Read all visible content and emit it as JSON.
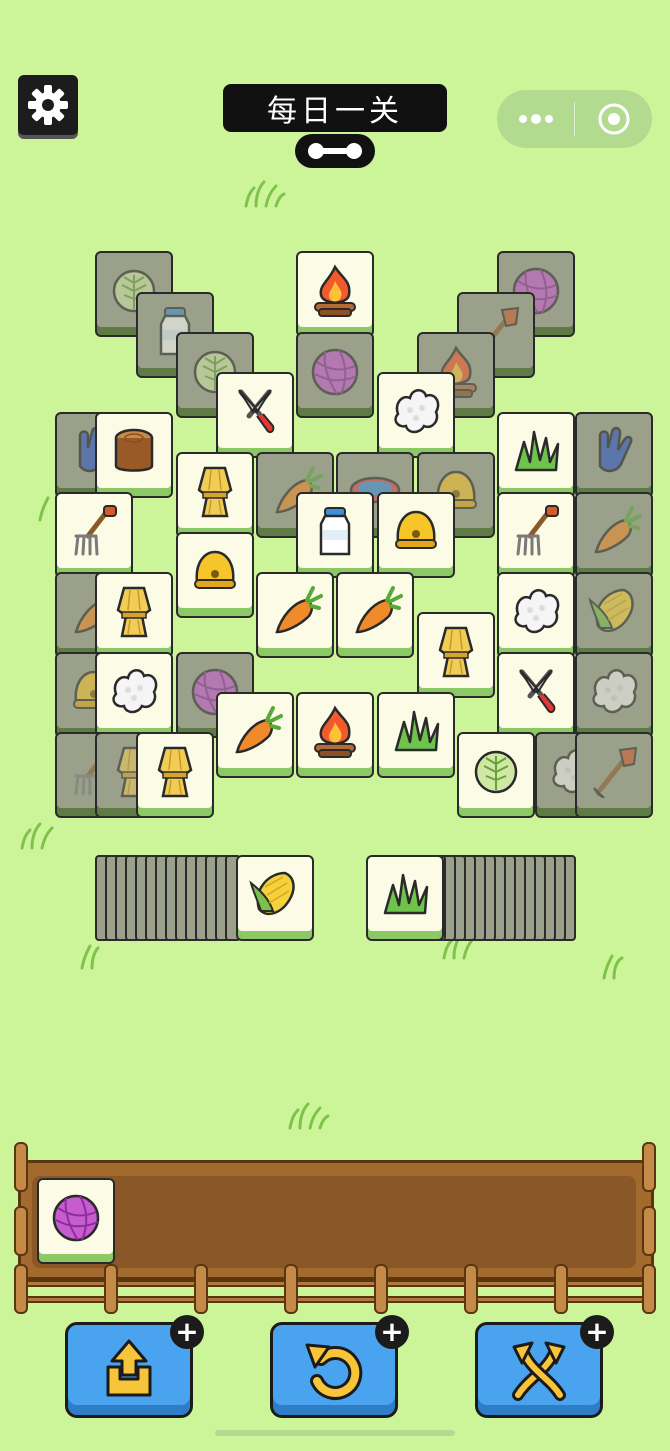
{
  "title": "每日一关",
  "settings_icon": "gear-icon",
  "capsule": {
    "menu_icon": "more-dots-icon",
    "close_icon": "target-close-icon"
  },
  "board": {
    "tiles": [
      {
        "item": "cabbage",
        "dim": true
      },
      {
        "item": "campfire",
        "dim": false
      },
      {
        "item": "yarn",
        "dim": true
      },
      {
        "item": "milk",
        "dim": true
      },
      {
        "item": "shovel",
        "dim": true
      },
      {
        "item": "cabbage",
        "dim": true
      },
      {
        "item": "yarn",
        "dim": true
      },
      {
        "item": "campfire",
        "dim": true
      },
      {
        "item": "glove",
        "dim": true
      },
      {
        "item": "glove",
        "dim": true
      },
      {
        "item": "shears",
        "dim": false
      },
      {
        "item": "cauliflower",
        "dim": false
      },
      {
        "item": "stump",
        "dim": false
      },
      {
        "item": "wheat",
        "dim": false
      },
      {
        "item": "carrot",
        "dim": true
      },
      {
        "item": "bowl",
        "dim": true
      },
      {
        "item": "bell",
        "dim": true
      },
      {
        "item": "grass",
        "dim": false
      },
      {
        "item": "fork",
        "dim": false
      },
      {
        "item": "milk",
        "dim": false
      },
      {
        "item": "bell",
        "dim": false
      },
      {
        "item": "fork",
        "dim": false
      },
      {
        "item": "carrot",
        "dim": true
      },
      {
        "item": "carrot",
        "dim": true
      },
      {
        "item": "wheat",
        "dim": false
      },
      {
        "item": "bell",
        "dim": false
      },
      {
        "item": "carrot",
        "dim": false
      },
      {
        "item": "carrot",
        "dim": false
      },
      {
        "item": "cauliflower",
        "dim": false
      },
      {
        "item": "corn",
        "dim": true
      },
      {
        "item": "bell",
        "dim": true
      },
      {
        "item": "cauliflower",
        "dim": false
      },
      {
        "item": "yarn",
        "dim": true
      },
      {
        "item": "wheat",
        "dim": false
      },
      {
        "item": "shears",
        "dim": false
      },
      {
        "item": "cauliflower",
        "dim": true
      },
      {
        "item": "fork",
        "dim": true
      },
      {
        "item": "wheat",
        "dim": true
      },
      {
        "item": "wheat",
        "dim": false
      },
      {
        "item": "carrot",
        "dim": false
      },
      {
        "item": "campfire",
        "dim": false
      },
      {
        "item": "grass",
        "dim": false
      },
      {
        "item": "cabbage",
        "dim": false
      },
      {
        "item": "cauliflower",
        "dim": true
      },
      {
        "item": "shovel",
        "dim": true
      }
    ]
  },
  "left_stack": {
    "top_item": "corn"
  },
  "right_stack": {
    "top_item": "grass"
  },
  "tray": {
    "slots": [
      "yarn"
    ]
  },
  "powerups": [
    {
      "name": "move-out",
      "icon": "move-out-arrow-icon",
      "badge": "+"
    },
    {
      "name": "undo",
      "icon": "undo-arrow-icon",
      "badge": "+"
    },
    {
      "name": "shuffle",
      "icon": "shuffle-arrows-icon",
      "badge": "+"
    }
  ]
}
